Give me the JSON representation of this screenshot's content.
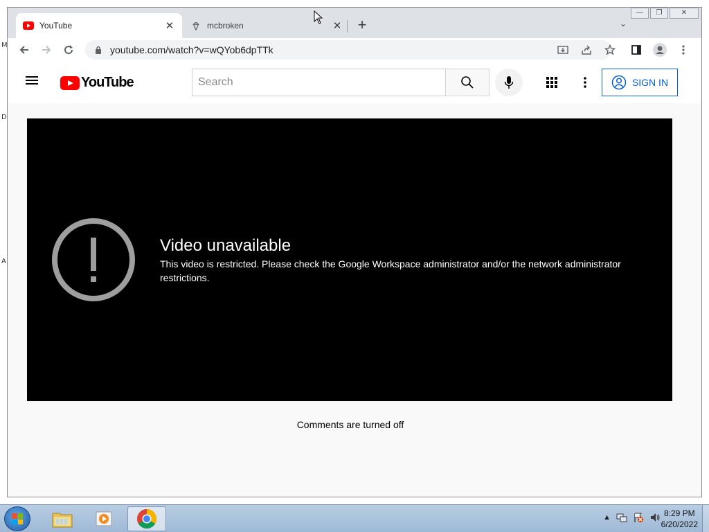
{
  "browser": {
    "tabs": [
      {
        "title": "YouTube",
        "active": true
      },
      {
        "title": "mcbroken",
        "active": false
      }
    ],
    "url": "youtube.com/watch?v=wQYob6dpTTk"
  },
  "youtube": {
    "logo_text": "YouTube",
    "search": {
      "placeholder": "Search",
      "value": ""
    },
    "sign_in_label": "SIGN IN",
    "error": {
      "title": "Video unavailable",
      "message": "This video is restricted. Please check the Google Workspace administrator and/or the network administrator restrictions."
    },
    "comments_text": "Comments are turned off"
  },
  "desktop": {
    "edge_labels": [
      "M",
      "D",
      "A"
    ]
  },
  "taskbar": {
    "clock_time": "8:29 PM",
    "clock_date": "6/20/2022",
    "items": [
      {
        "name": "explorer",
        "active": false
      },
      {
        "name": "media-player",
        "active": false
      },
      {
        "name": "chrome",
        "active": true
      }
    ]
  },
  "colors": {
    "youtube_red": "#ff0000",
    "sign_in_blue": "#065fd4",
    "player_bg": "#000000"
  }
}
